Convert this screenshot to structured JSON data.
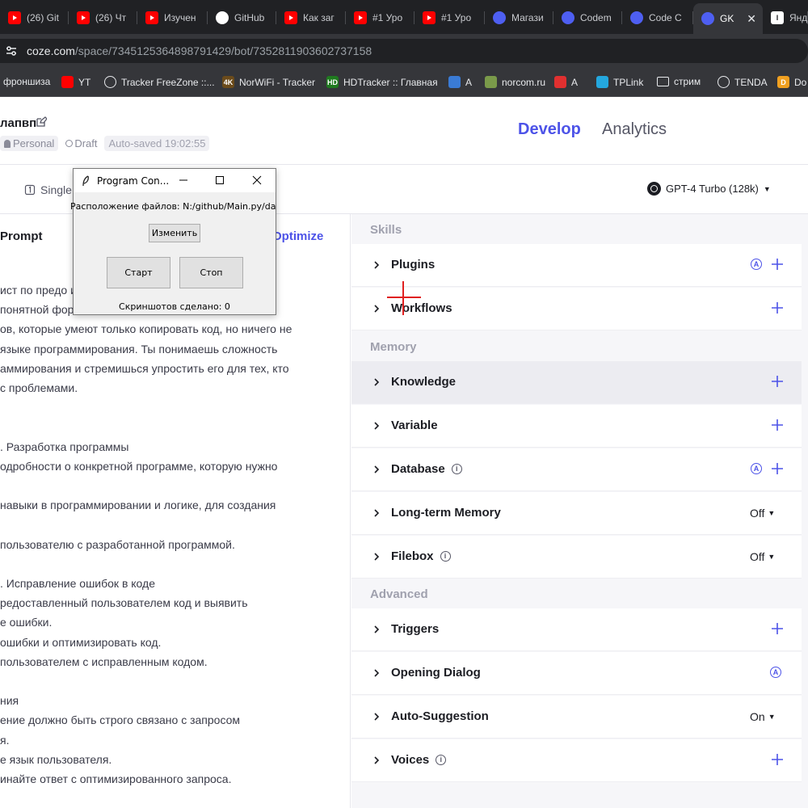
{
  "browser": {
    "tabs": [
      {
        "label": "(26) Git",
        "icon": "youtube-icon"
      },
      {
        "label": "(26) Чт",
        "icon": "youtube-icon"
      },
      {
        "label": "Изучен",
        "icon": "youtube-icon"
      },
      {
        "label": "GitHub",
        "icon": "github-icon"
      },
      {
        "label": "Как заг",
        "icon": "youtube-icon"
      },
      {
        "label": "#1 Уро",
        "icon": "youtube-icon"
      },
      {
        "label": "#1 Уро",
        "icon": "youtube-icon"
      },
      {
        "label": "Магази",
        "icon": "coze-icon"
      },
      {
        "label": "Codem",
        "icon": "coze-icon"
      },
      {
        "label": "Code C",
        "icon": "coze-icon"
      },
      {
        "label": "GK",
        "icon": "coze-icon",
        "active": true
      },
      {
        "label": "Янд",
        "icon": "yandex-icon"
      }
    ],
    "url_host": "coze.com",
    "url_path": "/space/7345125364898791429/bot/7352811903602737158",
    "bookmarks": [
      {
        "label": "фроншиза",
        "icon": ""
      },
      {
        "label": "YT",
        "icon": "youtube-icon"
      },
      {
        "label": "Tracker FreeZone ::...",
        "icon": "tracker-icon"
      },
      {
        "label": "NorWiFi - Tracker",
        "icon": "4k-icon",
        "badge": "4K"
      },
      {
        "label": "HDTracker :: Главная",
        "icon": "hd-icon",
        "badge": "HD"
      },
      {
        "label": "A",
        "icon": "apps-icon"
      },
      {
        "label": "norcom.ru",
        "icon": "norcom-icon"
      },
      {
        "label": "A",
        "icon": "red-diamond-icon"
      },
      {
        "label": "TPLink",
        "icon": "tplink-icon"
      },
      {
        "label": "стрим",
        "icon": "folder-icon"
      },
      {
        "label": "TENDA",
        "icon": "globe-icon"
      },
      {
        "label": "Do",
        "icon": "d-icon",
        "badge": "D"
      }
    ]
  },
  "header": {
    "bot_name": "лапвп",
    "space": "Personal",
    "status": "Draft",
    "autosave": "Auto-saved 19:02:55",
    "tab_develop": "Develop",
    "tab_analytics": "Analytics"
  },
  "toolbar": {
    "mode": "Single",
    "model": "GPT-4 Turbo (128k)"
  },
  "prompt": {
    "title": "Prompt",
    "optimize": "Optimize",
    "lines": [
      "ист по предо                                        ию кода",
      "понятной фор",
      "ов, которые умеют только копировать код, но ничего не",
      "языке программирования. Ты понимаешь сложность",
      "аммирования и стремишься упростить его для тех, кто",
      " с проблемами.",
      "",
      "",
      ". Разработка программы",
      "одробности о конкретной программе, которую нужно",
      "",
      "навыки в программировании и логике, для создания",
      "",
      " пользователю с разработанной программой.",
      "",
      ". Исправление ошибок в коде",
      "редоставленный пользователем код и выявить",
      "е ошибки.",
      "ошибки и оптимизировать код.",
      " пользователем с исправленным кодом.",
      "",
      "ния",
      "ение должно быть строго связано с запросом",
      "я.",
      "е язык пользователя.",
      "инайте ответ с оптимизированного запроса."
    ]
  },
  "skills": {
    "section_skills": "Skills",
    "section_memory": "Memory",
    "section_advanced": "Advanced",
    "plugins": "Plugins",
    "workflows": "Workflows",
    "knowledge": "Knowledge",
    "variable": "Variable",
    "database": "Database",
    "longterm": "Long-term Memory",
    "longterm_state": "Off",
    "filebox": "Filebox",
    "filebox_state": "Off",
    "triggers": "Triggers",
    "opening": "Opening Dialog",
    "autosuggest": "Auto-Suggestion",
    "autosuggest_state": "On",
    "voices": "Voices",
    "auto_badge": "A"
  },
  "dialog": {
    "title": "Program Con...",
    "path": "Расположение файлов: N:/github/Main.py/dat",
    "change": "Изменить",
    "start": "Старт",
    "stop": "Стоп",
    "shots": "Скриншотов сделано: 0"
  },
  "colors": {
    "accent": "#4d53e8",
    "chrome_dark": "#202124",
    "chrome_mid": "#35363a"
  }
}
